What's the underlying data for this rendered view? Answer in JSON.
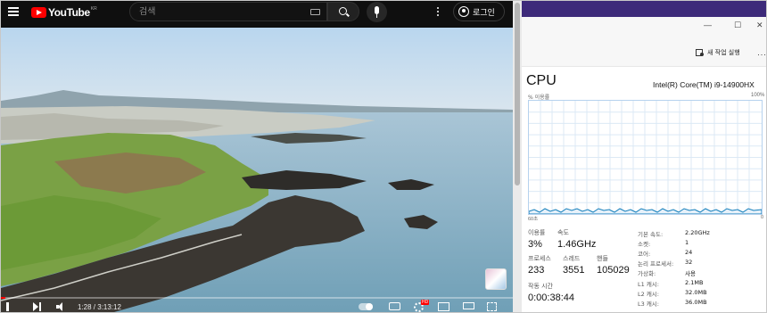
{
  "youtube": {
    "logo_text": "YouTube",
    "region": "KR",
    "search_placeholder": "검색",
    "login_label": "로그인",
    "time_display": "1:28 / 3:13:12",
    "progress_fraction": 0.008
  },
  "task_manager": {
    "toolbar": {
      "new_task_label": "새 작업 실행",
      "more_label": "···"
    },
    "window_controls": {
      "minimize": "—",
      "maximize": "☐",
      "close": "✕"
    },
    "cpu_title": "CPU",
    "cpu_model": "Intel(R) Core(TM) i9-14900HX",
    "graph": {
      "utilization_label": "% 이용률",
      "max_label": "100%",
      "time_label": "60초",
      "zero_label": "0"
    },
    "stats": {
      "utilization_label": "이용률",
      "utilization": "3%",
      "speed_label": "속도",
      "speed": "1.46GHz",
      "processes_label": "프로세스",
      "processes": "233",
      "threads_label": "스레드",
      "threads": "3551",
      "handles_label": "핸들",
      "handles": "105029",
      "uptime_label": "작동 시간",
      "uptime": "0:00:38:44"
    },
    "specs": [
      {
        "label": "기본 속도:",
        "value": "2.20GHz"
      },
      {
        "label": "소켓:",
        "value": "1"
      },
      {
        "label": "코어:",
        "value": "24"
      },
      {
        "label": "논리 프로세서:",
        "value": "32"
      },
      {
        "label": "가상화:",
        "value": "사용"
      },
      {
        "label": "L1 캐시:",
        "value": "2.1MB"
      },
      {
        "label": "L2 캐시:",
        "value": "32.0MB"
      },
      {
        "label": "L3 캐시:",
        "value": "36.0MB"
      }
    ]
  }
}
